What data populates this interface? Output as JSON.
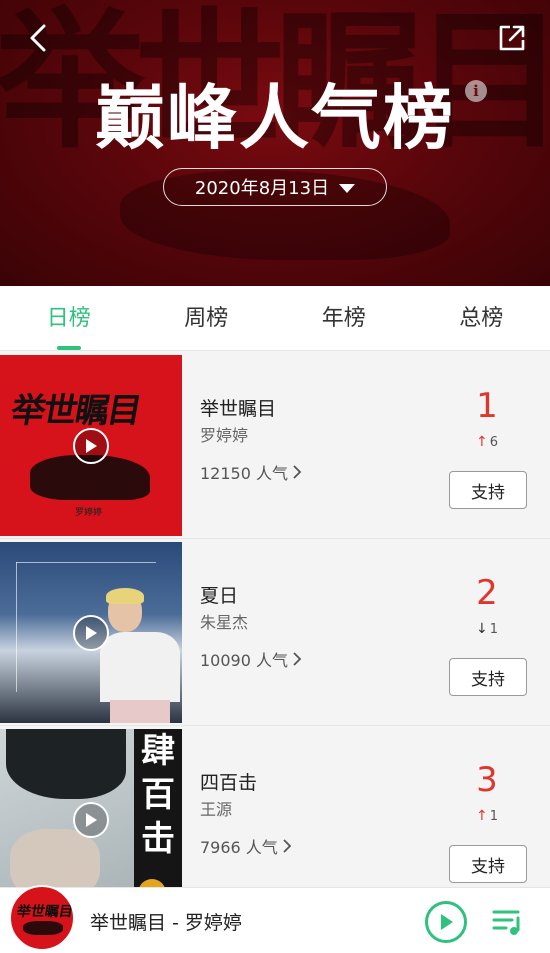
{
  "header": {
    "title": "巅峰人气榜",
    "date_selector": "2020年8月13日",
    "background_art_text": "举世瞩目"
  },
  "tabs": [
    {
      "label": "日榜",
      "active": true
    },
    {
      "label": "周榜",
      "active": false
    },
    {
      "label": "年榜",
      "active": false
    },
    {
      "label": "总榜",
      "active": false
    }
  ],
  "songs": [
    {
      "title": "举世瞩目",
      "artist": "罗婷婷",
      "popularity": "12150 人气",
      "rank": "1",
      "trend": {
        "direction": "up",
        "value": "6"
      },
      "support_label": "支持",
      "cover_text": "举世瞩目",
      "cover_signature": "罗婷婷"
    },
    {
      "title": "夏日",
      "artist": "朱星杰",
      "popularity": "10090 人气",
      "rank": "2",
      "trend": {
        "direction": "down",
        "value": "1"
      },
      "support_label": "支持"
    },
    {
      "title": "四百击",
      "artist": "王源",
      "popularity": "7966 人气",
      "rank": "3",
      "trend": {
        "direction": "up",
        "value": "1"
      },
      "support_label": "支持",
      "cover_text": "肆百击"
    }
  ],
  "player": {
    "now_playing": "举世瞩目 - 罗婷婷",
    "cover_text": "举世瞩目"
  },
  "colors": {
    "accent_green": "#2ec27e",
    "rank_red": "#e0352b",
    "header_red": "#6b0a0f"
  }
}
